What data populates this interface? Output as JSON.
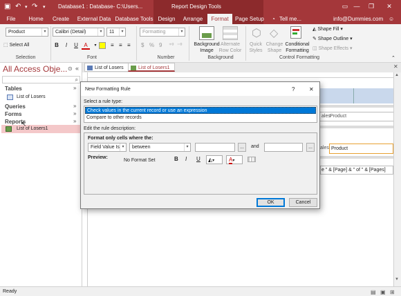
{
  "title_bar": {
    "doc_title": "Database1 : Database- C:\\Users...",
    "context_title": "Report Design Tools",
    "user": "info@Dummies.com",
    "help": "?",
    "minimize": "—",
    "restore": "❐",
    "close": "✕"
  },
  "ribbon_tabs": [
    "File",
    "Home",
    "Create",
    "External Data",
    "Database Tools",
    "Design",
    "Arrange",
    "Format",
    "Page Setup"
  ],
  "tell_me": "Tell me...",
  "selection_group": {
    "object_combo": "Product",
    "select_all": "Select All",
    "label": "Selection"
  },
  "font_group": {
    "font_name": "Calibri (Detail)",
    "font_size": "11",
    "bold": "B",
    "italic": "I",
    "underline": "U",
    "font_color": "A",
    "label": "Font"
  },
  "number_group": {
    "format_combo": "Formatting",
    "dollar": "$",
    "percent": "%",
    "comma": "9",
    "label": "Number"
  },
  "background_group": {
    "background_image": "Background Image",
    "alternate_row_color": "Alternate Row Color",
    "label": "Background"
  },
  "control_formatting_group": {
    "quick_styles": "Quick Styles",
    "change_shape": "Change Shape",
    "conditional_formatting": "Conditional Formatting",
    "shape_fill": "Shape Fill",
    "shape_outline": "Shape Outline",
    "shape_effects": "Shape Effects",
    "label": "Control Formatting"
  },
  "nav_pane": {
    "title": "All Access Obje...",
    "search_icon": "⌕",
    "sections": [
      {
        "label": "Tables",
        "items": [
          "List of Losers"
        ]
      },
      {
        "label": "Queries",
        "items": []
      },
      {
        "label": "Forms",
        "items": []
      },
      {
        "label": "Reports",
        "items": [
          "List of Losers1"
        ]
      }
    ]
  },
  "doc_tabs": [
    "List of Losers",
    "List of Losers1"
  ],
  "report_fragments": {
    "label_product": "ales",
    "field_product": "Product",
    "field_product_ctrl": "Product",
    "label_sales": "ales",
    "footer_expr": "e \" & [Page] & \" of \" & [Pages]"
  },
  "dialog": {
    "title": "New Formatting Rule",
    "help": "?",
    "close": "✕",
    "rule_type_label": "Select a rule type:",
    "rule_types": [
      "Check values in the current record or use an expression",
      "Compare to other records"
    ],
    "selected_rule_index": 0,
    "edit_label": "Edit the rule description:",
    "format_only_label": "Format only cells where the:",
    "condition_field": "Field Value Is",
    "condition_operator": "between",
    "value1": "",
    "value2": "",
    "and_label": "and",
    "ellipsis": "...",
    "preview_label": "Preview:",
    "preview_text": "No Format Set",
    "fmt_bold": "B",
    "fmt_italic": "I",
    "fmt_underline": "U",
    "ok": "OK",
    "cancel": "Cancel"
  },
  "status": "Ready"
}
